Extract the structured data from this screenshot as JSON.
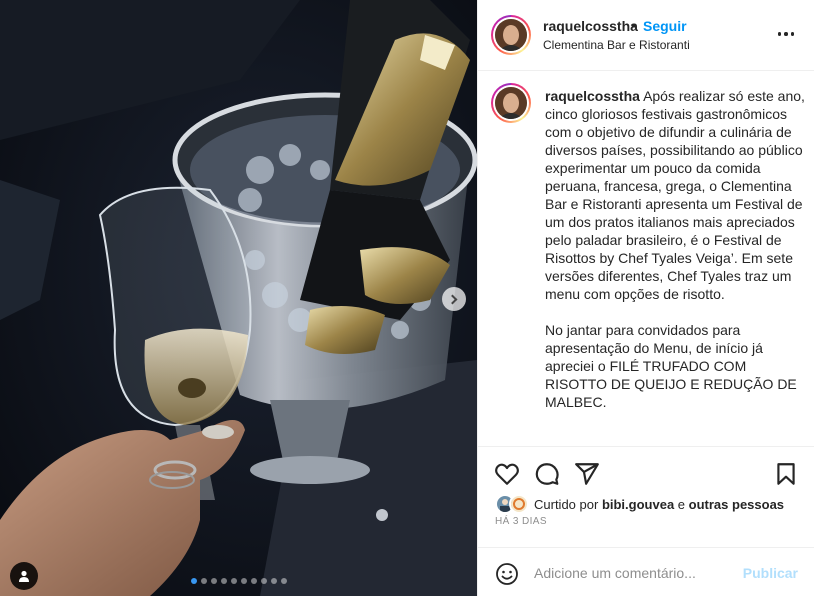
{
  "post": {
    "username": "raquelcosstha",
    "separator": "•",
    "follow_label": "Seguir",
    "location": "Clementina Bar e Ristoranti",
    "more_icon": "more-options-icon"
  },
  "caption": {
    "username": "raquelcosstha",
    "paragraph1": "Após realizar só este ano, cinco gloriosos festivais gastronômicos com o objetivo de difundir a culinária de diversos países, possibilitando ao público experimentar um pouco da comida peruana, francesa, grega, o Clementina Bar e Ristoranti apresenta um Festival de um dos pratos italianos mais apreciados pelo paladar brasileiro, é o Festival de Risottos by Chef Tyales Veiga’. Em sete versões diferentes, Chef Tyales traz um menu com opções de risotto.",
    "paragraph2": "No jantar para convidados para apresentação do Menu, de início já apreciei o FILÉ TRUFADO COM RISOTTO DE QUEIJO E REDUÇÃO DE MALBEC."
  },
  "actions": {
    "like_icon": "heart-icon",
    "comment_icon": "comment-icon",
    "share_icon": "share-icon",
    "save_icon": "bookmark-icon"
  },
  "likes": {
    "prefix": "Curtido por",
    "user": "bibi.gouvea",
    "connector": "e",
    "others": "outras pessoas"
  },
  "timestamp": "HÁ 3 DIAS",
  "comment": {
    "placeholder": "Adicione um comentário...",
    "publish_label": "Publicar",
    "emoji_icon": "emoji-icon"
  },
  "carousel": {
    "total_slides": 10,
    "current_slide": 1,
    "next_icon": "chevron-right-icon",
    "tag_icon": "user-tag-icon"
  },
  "colors": {
    "follow_blue": "#0095f6",
    "publish_disabled": "#b2dffc",
    "secondary_text": "#8e8e8e",
    "border": "#efefef"
  }
}
